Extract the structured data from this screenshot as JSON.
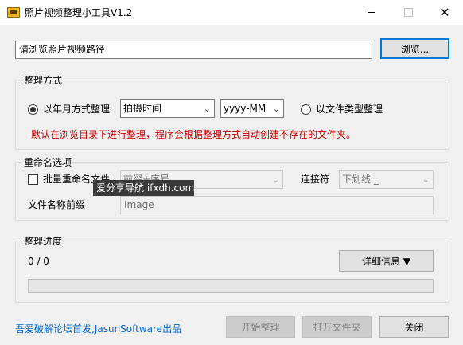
{
  "window": {
    "title": "照片视频整理小工具V1.2"
  },
  "path": {
    "placeholder_value": "请浏览照片视频路径",
    "browse_label": "浏览..."
  },
  "organize": {
    "group_title": "整理方式",
    "by_date_label": "以年月方式整理",
    "date_source_value": "拍摄时间",
    "date_format_value": "yyyy-MM",
    "by_type_label": "以文件类型整理",
    "hint": "默认在浏览目录下进行整理，程序会根据整理方式自动创建不存在的文件夹。",
    "selected": "by_date"
  },
  "rename": {
    "group_title": "重命名选项",
    "batch_label": "批量重命名文件",
    "batch_checked": false,
    "pattern_value": "前缀+序号",
    "connector_label": "连接符",
    "connector_value": "下划线 _",
    "prefix_label": "文件名称前缀",
    "prefix_value": "Image"
  },
  "progress": {
    "group_title": "整理进度",
    "count_text": "0 / 0",
    "details_label": "详细信息 ▼",
    "fraction": 0
  },
  "footer": {
    "credit": "吾爱破解论坛首发,JasunSoftware出品",
    "start_label": "开始整理",
    "open_folder_label": "打开文件夹",
    "close_label": "关闭"
  },
  "overlay": {
    "watermark": "爱分享导航 ifxdh.com"
  },
  "colors": {
    "hint_red": "#c00000",
    "link_blue": "#0066cc",
    "accent_blue": "#0078d7"
  }
}
